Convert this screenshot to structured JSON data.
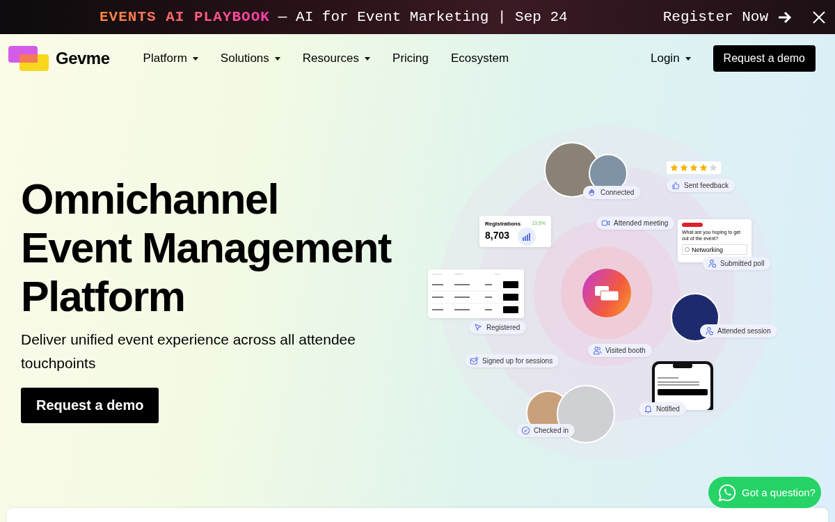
{
  "banner": {
    "highlight": "EVENTS AI PLAYBOOK",
    "text": "— AI for Event Marketing | Sep 24",
    "cta": "Register Now"
  },
  "nav": {
    "brand": "Gevme",
    "items": [
      {
        "label": "Platform",
        "kind": "dropdown"
      },
      {
        "label": "Solutions",
        "kind": "dropdown"
      },
      {
        "label": "Resources",
        "kind": "dropdown"
      },
      {
        "label": "Pricing",
        "kind": "link"
      },
      {
        "label": "Ecosystem",
        "kind": "link"
      }
    ],
    "login": "Login",
    "demo": "Request a demo"
  },
  "hero": {
    "title_lines": [
      "Omnichannel",
      "Event Management",
      "Platform"
    ],
    "subtitle": "Deliver unified event experience across all attendee touchpoints",
    "cta": "Request a demo"
  },
  "illustration": {
    "stars": 4,
    "registrations": {
      "label": "Registrations",
      "change": "13.5%",
      "value": "8,703"
    },
    "poll": {
      "question": "What are you hoping to get out of the event?",
      "option": "Networking"
    },
    "pills": [
      {
        "label": "Connected"
      },
      {
        "label": "Sent feedback"
      },
      {
        "label": "Attended meeting"
      },
      {
        "label": "Submitted poll"
      },
      {
        "label": "Registered"
      },
      {
        "label": "Attended session"
      },
      {
        "label": "Visited booth"
      },
      {
        "label": "Signed up for sessions"
      },
      {
        "label": "Notified"
      },
      {
        "label": "Checked in"
      }
    ]
  },
  "chat": {
    "label": "Got a question?"
  }
}
